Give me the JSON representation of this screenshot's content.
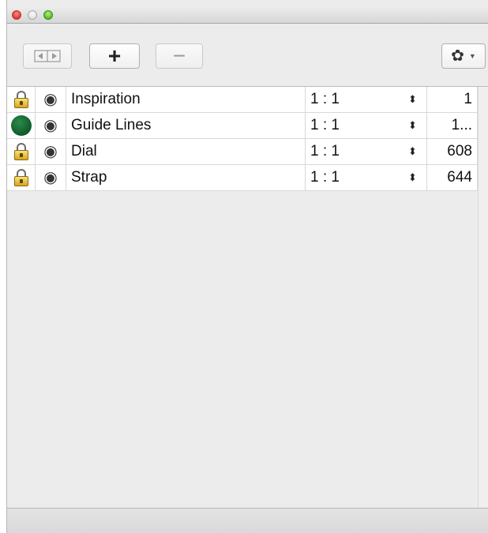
{
  "window": {
    "traffic_lights": [
      {
        "name": "close",
        "color": "#e0443c"
      },
      {
        "name": "minimize",
        "color": "#d5d5d5"
      },
      {
        "name": "zoom",
        "color": "#60c530"
      }
    ]
  },
  "toolbar": {
    "move_icon": "move-layer-icon",
    "add_label": "+",
    "remove_label": "−",
    "gear_icon": "gear-icon",
    "gear_glyph": "✿",
    "caret": "▼"
  },
  "layers": [
    {
      "lock": "lock-icon",
      "visibility": "eye-icon",
      "name": "Inspiration",
      "scale": "1 : 1",
      "value": "1"
    },
    {
      "lock": "green-dot",
      "visibility": "eye-icon",
      "name": "Guide Lines",
      "scale": "1 : 1",
      "value": "1..."
    },
    {
      "lock": "lock-icon",
      "visibility": "eye-icon",
      "name": "Dial",
      "scale": "1 : 1",
      "value": "608"
    },
    {
      "lock": "lock-icon",
      "visibility": "eye-icon",
      "name": "Strap",
      "scale": "1 : 1",
      "value": "644"
    }
  ],
  "colors": {
    "accent_green": "#0f5a2a",
    "lock_gold": "#d9a620"
  }
}
